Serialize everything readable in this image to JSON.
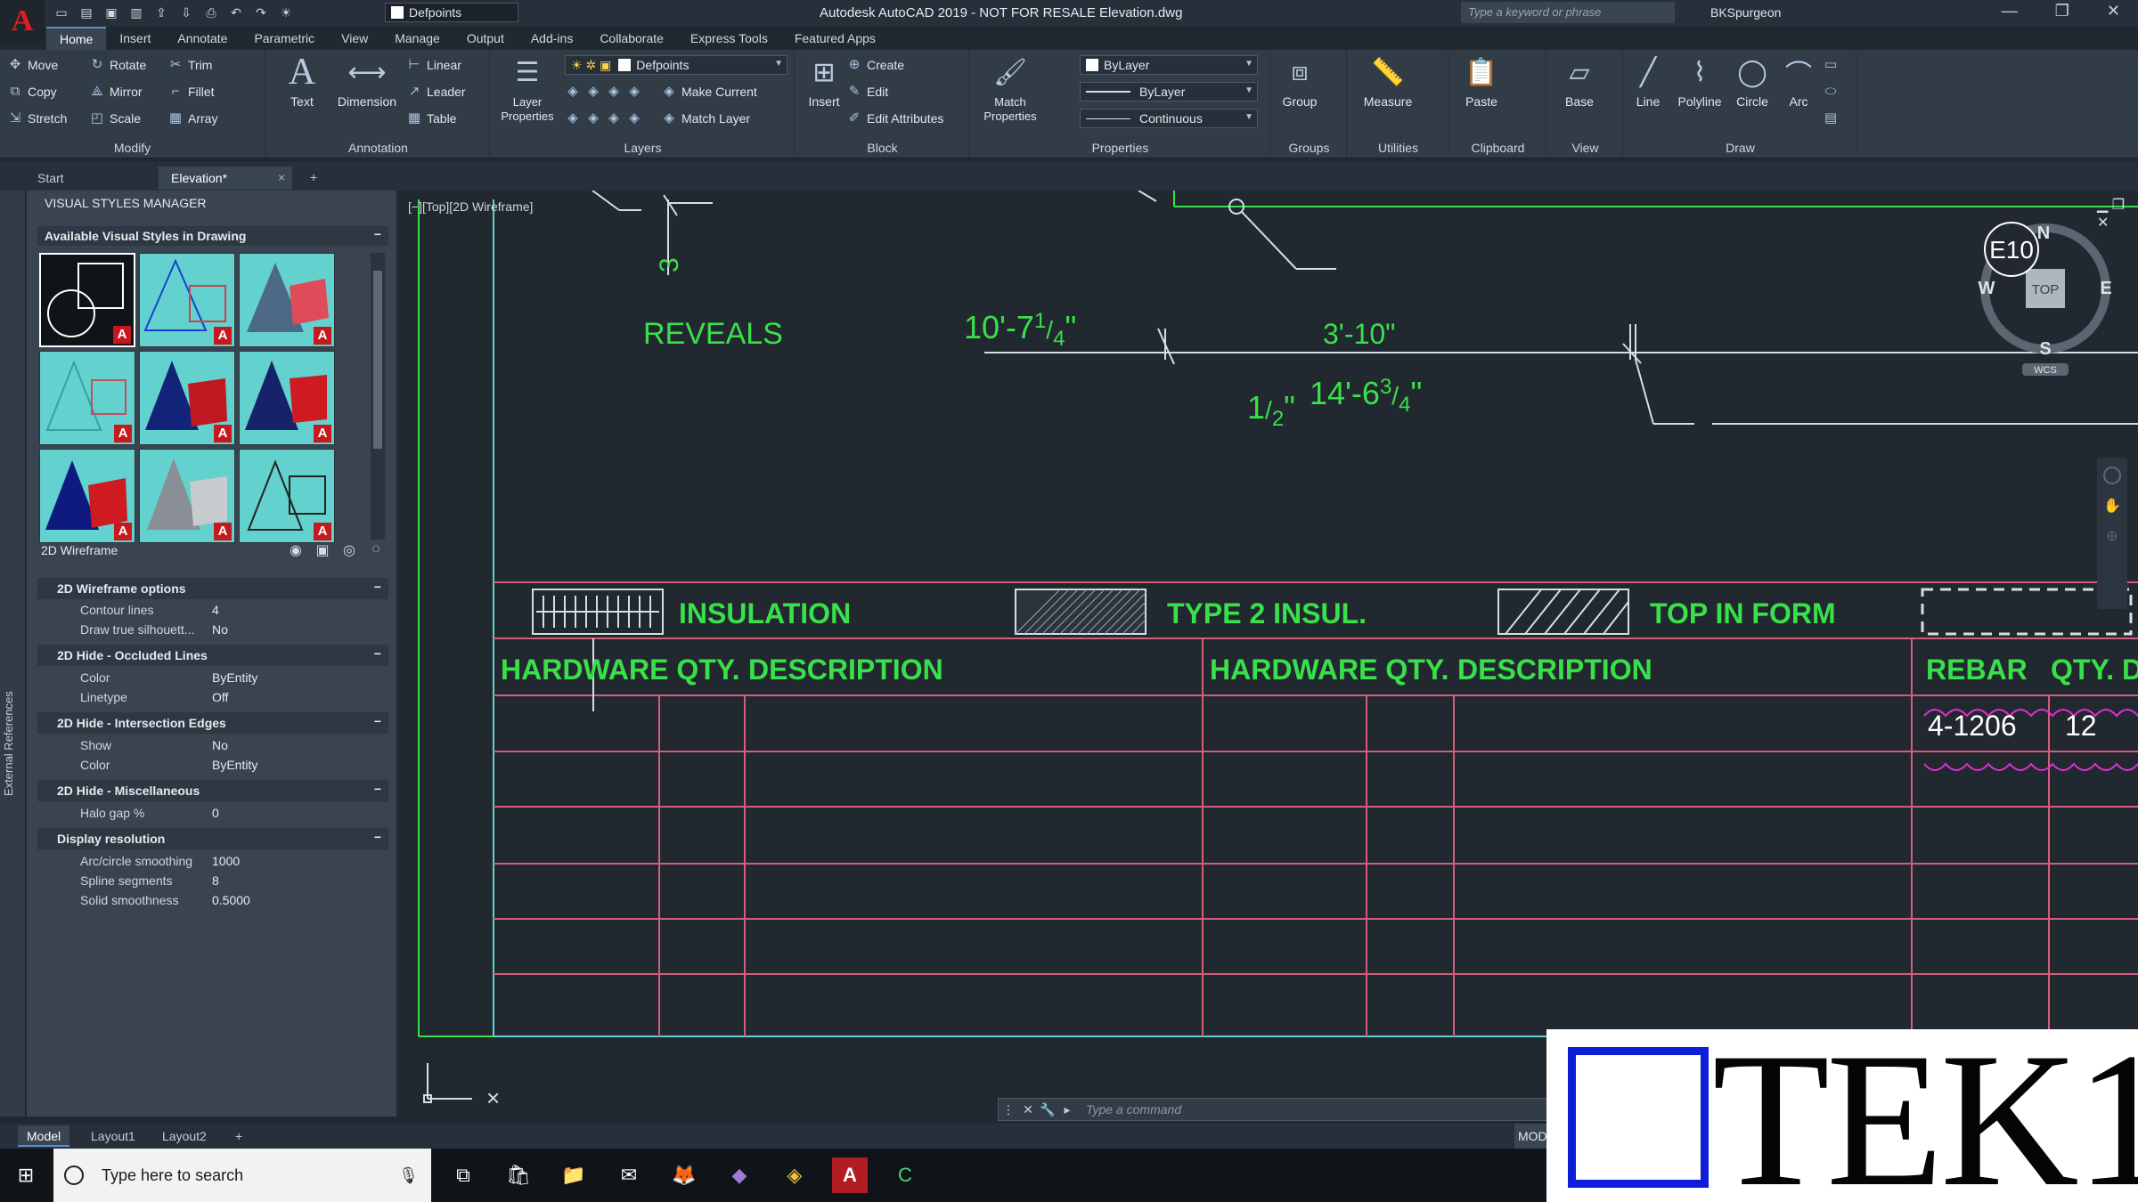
{
  "titlebar": {
    "logo": "A",
    "layer_combo": "Defpoints",
    "window_title": "Autodesk AutoCAD 2019 - NOT FOR RESALE   Elevation.dwg",
    "search_placeholder": "Type a keyword or phrase",
    "user": "BKSpurgeon"
  },
  "ribbon_tabs": [
    "Home",
    "Insert",
    "Annotate",
    "Parametric",
    "View",
    "Manage",
    "Output",
    "Add-ins",
    "Collaborate",
    "Express Tools",
    "Featured Apps"
  ],
  "ribbon": {
    "modify": {
      "title": "Modify",
      "move": "Move",
      "rotate": "Rotate",
      "trim": "Trim",
      "copy": "Copy",
      "mirror": "Mirror",
      "fillet": "Fillet",
      "stretch": "Stretch",
      "scale": "Scale",
      "array": "Array"
    },
    "annotation": {
      "title": "Annotation",
      "text": "Text",
      "dimension": "Dimension",
      "linear": "Linear",
      "leader": "Leader",
      "table": "Table"
    },
    "layers": {
      "title": "Layers",
      "layer_properties": "Layer Properties",
      "layer_combo": "Defpoints",
      "make_current": "Make Current",
      "match_layer": "Match Layer"
    },
    "block": {
      "title": "Block",
      "insert": "Insert",
      "create": "Create",
      "edit": "Edit",
      "edit_attributes": "Edit Attributes"
    },
    "properties": {
      "title": "Properties",
      "match_properties": "Match Properties",
      "color": "ByLayer",
      "lineweight": "ByLayer",
      "linetype": "Continuous"
    },
    "groups": {
      "title": "Groups",
      "group": "Group"
    },
    "utilities": {
      "title": "Utilities",
      "measure": "Measure"
    },
    "clipboard": {
      "title": "Clipboard",
      "paste": "Paste"
    },
    "view": {
      "title": "View",
      "base": "Base"
    },
    "draw": {
      "title": "Draw",
      "line": "Line",
      "polyline": "Polyline",
      "circle": "Circle",
      "arc": "Arc"
    }
  },
  "file_tabs": {
    "start": "Start",
    "current": "Elevation*"
  },
  "palette": {
    "strip_label": "External References",
    "title": "VISUAL STYLES MANAGER",
    "styles_header": "Available Visual Styles in Drawing",
    "current_style": "2D Wireframe",
    "sections": [
      {
        "title": "2D Wireframe options",
        "rows": [
          {
            "k": "Contour lines",
            "v": "4"
          },
          {
            "k": "Draw true silhouett...",
            "v": "No"
          }
        ]
      },
      {
        "title": "2D Hide - Occluded Lines",
        "rows": [
          {
            "k": "Color",
            "v": "ByEntity"
          },
          {
            "k": "Linetype",
            "v": "Off"
          }
        ]
      },
      {
        "title": "2D Hide - Intersection Edges",
        "rows": [
          {
            "k": "Show",
            "v": "No"
          },
          {
            "k": "Color",
            "v": "ByEntity"
          }
        ]
      },
      {
        "title": "2D Hide - Miscellaneous",
        "rows": [
          {
            "k": "Halo gap %",
            "v": "0"
          }
        ]
      },
      {
        "title": "Display resolution",
        "rows": [
          {
            "k": "Arc/circle smoothing",
            "v": "1000"
          },
          {
            "k": "Spline segments",
            "v": "8"
          },
          {
            "k": "Solid smoothness",
            "v": "0.5000"
          }
        ]
      }
    ]
  },
  "drawing": {
    "viewport_label": "[−][Top][2D Wireframe]",
    "reveals": "REVEALS",
    "dim_main": "10'-7",
    "dim_main_frac_num": "1",
    "dim_main_frac_den": "4",
    "dim_half": "1",
    "dim_half_den": "2",
    "dim_right": "14'-6",
    "dim_right_num": "3",
    "dim_right_den": "4",
    "dim_3_10": "3'-10\"",
    "dim_3": "3",
    "legend": {
      "insulation": "INSULATION",
      "type2": "TYPE 2 INSUL.",
      "top_in_form": "TOP IN FORM"
    },
    "table_headers": {
      "hw1": "HARDWARE QTY.",
      "desc1": "DESCRIPTION",
      "hw2": "HARDWARE QTY.",
      "desc2": "DESCRIPTION",
      "rebar": "REBAR",
      "qty": "QTY. D"
    },
    "rebar_row": {
      "rebar": "4-1206",
      "qty": "12"
    },
    "viewcube": {
      "tag": "E10",
      "n": "N",
      "s": "S",
      "e": "E",
      "w": "W",
      "top": "TOP",
      "wcs": "WCS"
    }
  },
  "command_line": {
    "placeholder": "Type a command"
  },
  "layout_tabs": {
    "model": "Model",
    "layout1": "Layout1",
    "layout2": "Layout2"
  },
  "status": {
    "model": "MOD"
  },
  "taskbar": {
    "search": "Type here to search"
  },
  "watermark": {
    "text": "TEK1"
  },
  "colors": {
    "green": "#39e04a",
    "table_red": "#d45e7a",
    "magenta_cloud": "#e030d0",
    "watermark_blue": "#0d1ed6"
  }
}
